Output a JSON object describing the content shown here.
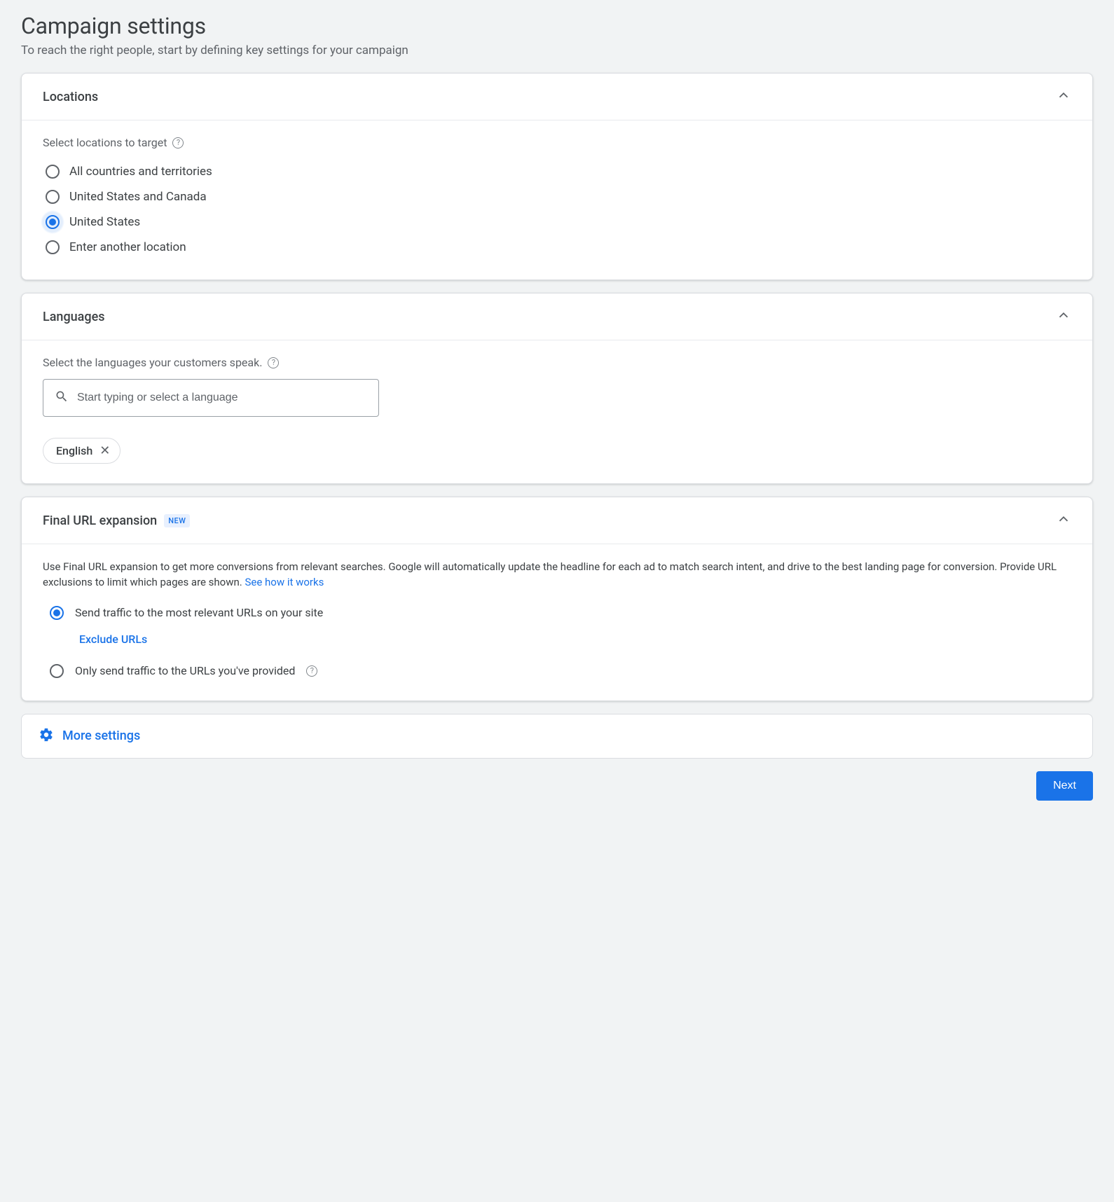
{
  "page": {
    "title": "Campaign settings",
    "subtitle": "To reach the right people, start by defining key settings for your campaign"
  },
  "locations": {
    "title": "Locations",
    "instruction": "Select locations to target",
    "options": [
      "All countries and territories",
      "United States and Canada",
      "United States",
      "Enter another location"
    ],
    "selected_index": 2
  },
  "languages": {
    "title": "Languages",
    "instruction": "Select the languages your customers speak.",
    "search_placeholder": "Start typing or select a language",
    "chips": [
      "English"
    ]
  },
  "url_expansion": {
    "title": "Final URL expansion",
    "badge": "NEW",
    "description": "Use Final URL expansion to get more conversions from relevant searches. Google will automatically update the headline for each ad to match search intent, and drive to the best landing page for conversion. Provide URL exclusions to limit which pages are shown. ",
    "learn_link": "See how it works",
    "options": [
      "Send traffic to the most relevant URLs on your site",
      "Only send traffic to the URLs you've provided"
    ],
    "selected_index": 0,
    "exclude_link": "Exclude URLs"
  },
  "more_settings": "More settings",
  "next_button": "Next"
}
